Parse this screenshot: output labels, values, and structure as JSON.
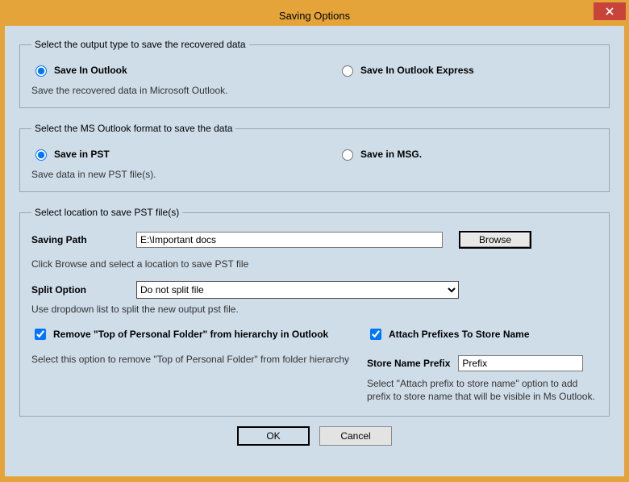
{
  "window": {
    "title": "Saving Options"
  },
  "group_output": {
    "legend": "Select the output type to save the recovered data",
    "opt_outlook": "Save In Outlook",
    "opt_express": "Save In Outlook Express",
    "hint": "Save the recovered data in Microsoft Outlook."
  },
  "group_format": {
    "legend": "Select the MS Outlook format to save the data",
    "opt_pst": "Save in PST",
    "opt_msg": "Save in MSG.",
    "hint": "Save data in new PST file(s)."
  },
  "group_location": {
    "legend": "Select location to save PST file(s)",
    "path_label": "Saving Path",
    "path_value": "E:\\Important docs",
    "browse": "Browse",
    "path_hint": "Click Browse and select a location to save PST file",
    "split_label": "Split Option",
    "split_value": "Do not split file",
    "split_hint": "Use dropdown list to split the new output pst file.",
    "chk_remove": "Remove \"Top of Personal Folder\" from hierarchy in Outlook",
    "remove_hint": "Select this option to remove \"Top of Personal Folder\" from folder hierarchy",
    "chk_attach": "Attach Prefixes To Store Name",
    "prefix_label": "Store Name Prefix",
    "prefix_value": "Prefix",
    "attach_hint": "Select \"Attach prefix to store name\" option to add prefix to store name that will be visible in Ms Outlook."
  },
  "buttons": {
    "ok": "OK",
    "cancel": "Cancel"
  }
}
